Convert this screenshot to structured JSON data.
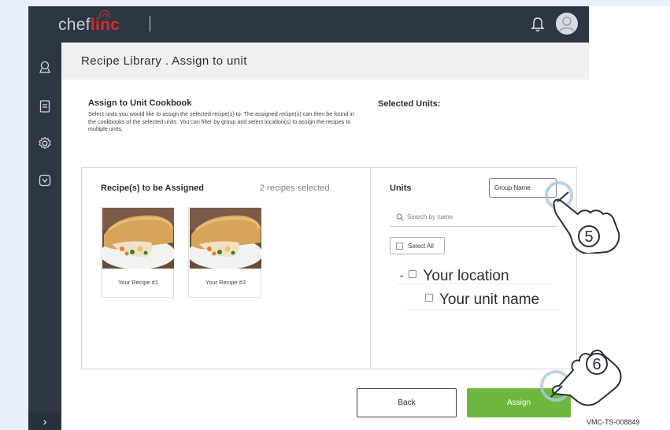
{
  "app": {
    "logo_text_a": "chef",
    "logo_text_b": "linc"
  },
  "header": {
    "page_title": "Recipe Library . Assign to unit"
  },
  "intro": {
    "title": "Assign to Unit Cookbook",
    "text": "Select units you would like to assign the selected recipe(s) to. The assigned recipe(s) can then be found in the cookbooks of the selected units. You can filter by group and select location(s) to assign the recipes to multiple units."
  },
  "selected_units_label": "Selected Units:",
  "recipes_panel": {
    "title": "Recipe(s) to be Assigned",
    "count": "2 recipes selected",
    "cards": [
      {
        "label": "Your Recipe #1"
      },
      {
        "label": "Your Recipe #3"
      }
    ]
  },
  "units_panel": {
    "title": "Units",
    "group_select": "Group Name",
    "search_placeholder": "Search by name",
    "select_all": "Select All",
    "location": "Your location",
    "unit": "Your unit name"
  },
  "buttons": {
    "back": "Back",
    "assign": "Assign"
  },
  "callouts": [
    "5",
    "6"
  ],
  "watermark": "VMC-TS-008849",
  "colors": {
    "sidebar": "#2c3742",
    "brand_red": "#d9272e",
    "assign_green": "#6fb83f",
    "callout_blue": "#a9c9dd"
  },
  "icons": [
    "bell-icon",
    "avatar-icon",
    "ribbon-icon",
    "document-icon",
    "gear-icon",
    "tag-icon",
    "search-icon",
    "chevron-down-icon",
    "chevron-right-icon",
    "hand-pointer-icon"
  ]
}
